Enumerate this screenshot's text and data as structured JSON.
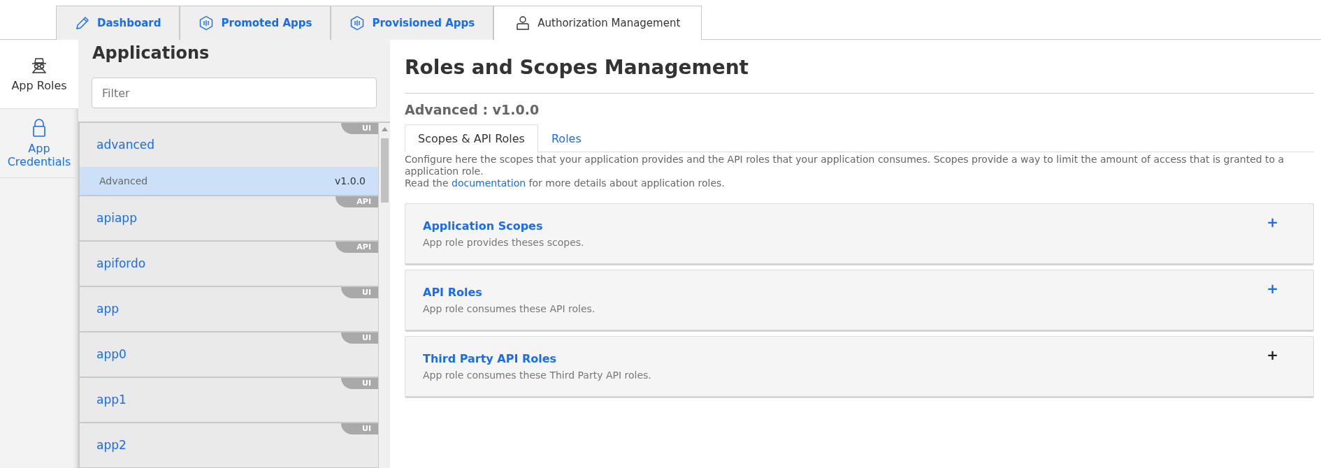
{
  "top_tabs": [
    {
      "label": "Dashboard",
      "selected": false
    },
    {
      "label": "Promoted Apps",
      "selected": false
    },
    {
      "label": "Provisioned Apps",
      "selected": false
    },
    {
      "label": "Authorization Management",
      "selected": true
    }
  ],
  "side_nav": [
    {
      "label": "App Roles",
      "selected": true
    },
    {
      "label": "App Credentials",
      "selected": false
    }
  ],
  "applications": {
    "title": "Applications",
    "filter_placeholder": "Filter",
    "items": [
      {
        "name": "advanced",
        "badge": "UI",
        "versions": [
          {
            "name": "Advanced",
            "version": "v1.0.0",
            "selected": true
          }
        ]
      },
      {
        "name": "apiapp",
        "badge": "API"
      },
      {
        "name": "apifordo",
        "badge": "API"
      },
      {
        "name": "app",
        "badge": "UI"
      },
      {
        "name": "app0",
        "badge": "UI"
      },
      {
        "name": "app1",
        "badge": "UI"
      },
      {
        "name": "app2",
        "badge": "UI"
      }
    ]
  },
  "main": {
    "title": "Roles and Scopes Management",
    "subtitle": "Advanced : v1.0.0",
    "tabs": [
      {
        "label": "Scopes & API Roles",
        "selected": true
      },
      {
        "label": "Roles",
        "selected": false
      }
    ],
    "description": "Configure here the scopes that your application provides and the API roles that your application consumes. Scopes provide a way to limit the amount of access that is granted to a application role.",
    "doc_before": "Read the ",
    "doc_link": "documentation",
    "doc_after": " for more details about application roles.",
    "panels": [
      {
        "title": "Application Scopes",
        "text": "App role provides theses scopes.",
        "plus": "+",
        "color": "#1a6cf0"
      },
      {
        "title": "API Roles",
        "text": "App role consumes these API roles.",
        "plus": "+",
        "color": "#1a6cf0"
      },
      {
        "title": "Third Party API Roles",
        "text": "App role consumes these Third Party API roles.",
        "plus": "+",
        "color": "#222222"
      }
    ]
  }
}
